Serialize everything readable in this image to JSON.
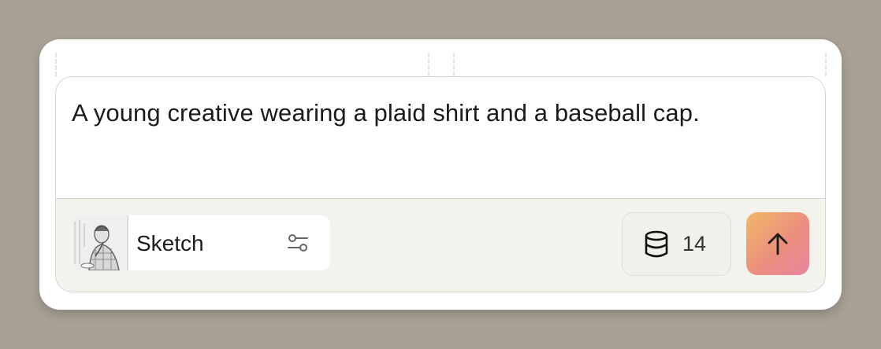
{
  "prompt": {
    "text": "A young creative wearing a plaid shirt and a baseball cap."
  },
  "style": {
    "label": "Sketch",
    "thumbnail_icon": "sketch-style-thumbnail",
    "settings_icon": "sliders-icon"
  },
  "credits": {
    "icon": "database-icon",
    "count": "14"
  },
  "send": {
    "icon": "arrow-up-icon",
    "gradient": [
      "#f0b868",
      "#eb8f7d",
      "#e885a2"
    ]
  },
  "colors": {
    "background": "#a8a195",
    "card": "#ffffff",
    "footer": "#f3f3ee"
  }
}
